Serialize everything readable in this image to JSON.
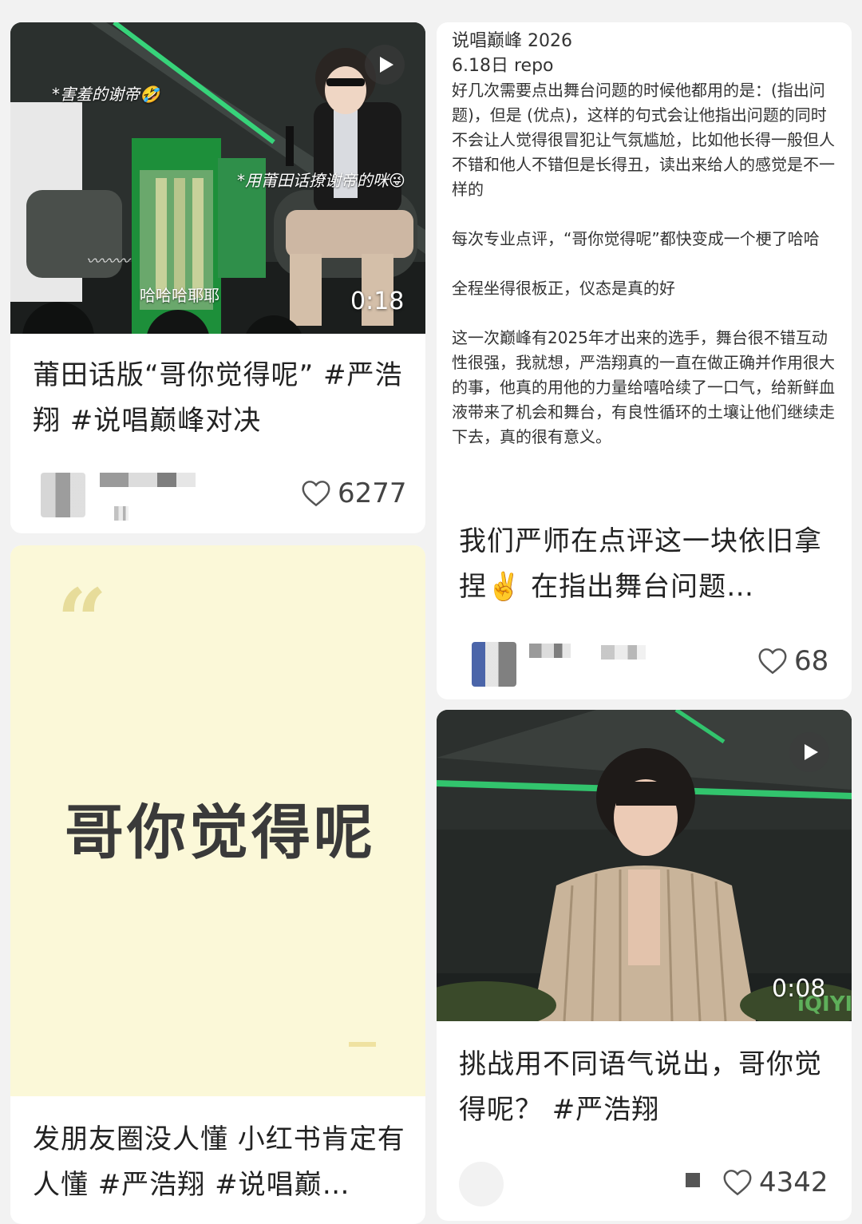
{
  "card1": {
    "caption_top": "*害羞的谢帝🤣",
    "caption_mid": "*用莆田话撩谢帝的咪😜",
    "caption_bottom": "哈哈哈耶耶",
    "duration": "0:18",
    "title": "莆田话版“哥你觉得呢” #严浩翔 #说唱巅峰对决",
    "likes": "6277"
  },
  "card2": {
    "header": "说唱巅峰 2026",
    "subheader": "6.18日 repo",
    "para1": "好几次需要点出舞台问题的时候他都用的是：(指出问题)，但是 (优点)，这样的句式会让他指出问题的同时不会让人觉得很冒犯让气氛尴尬，比如他长得一般但人不错和他人不错但是长得丑，读出来给人的感觉是不一样的",
    "para2": "每次专业点评，“哥你觉得呢”都快变成一个梗了哈哈",
    "para3": "全程坐得很板正，仪态是真的好",
    "para4": "这一次巅峰有2025年才出来的选手，舞台很不错互动性很强，我就想，严浩翔真的一直在做正确并作用很大的事，他真的用他的力量给嘻哈续了一口气，给新鲜血液带来了机会和舞台，有良性循环的土壤让他们继续走下去，真的很有意义。",
    "title": "我们严师在点评这一块依旧拿捏✌️ 在指出舞台问题…",
    "likes": "68"
  },
  "card3": {
    "quote": "“",
    "phrase": "哥你觉得呢",
    "title": "发朋友圈没人懂 小红书肯定有人懂 #严浩翔 #说唱巅…"
  },
  "card4": {
    "duration": "0:08",
    "watermark": "iQIYI",
    "title": "挑战用不同语气说出，哥你觉得呢？ #严浩翔",
    "likes": "4342"
  },
  "colors": {
    "page_bg": "#f2f2f2",
    "quote_card_bg": "#fbf8d8",
    "accent_green": "#2ecc71"
  }
}
